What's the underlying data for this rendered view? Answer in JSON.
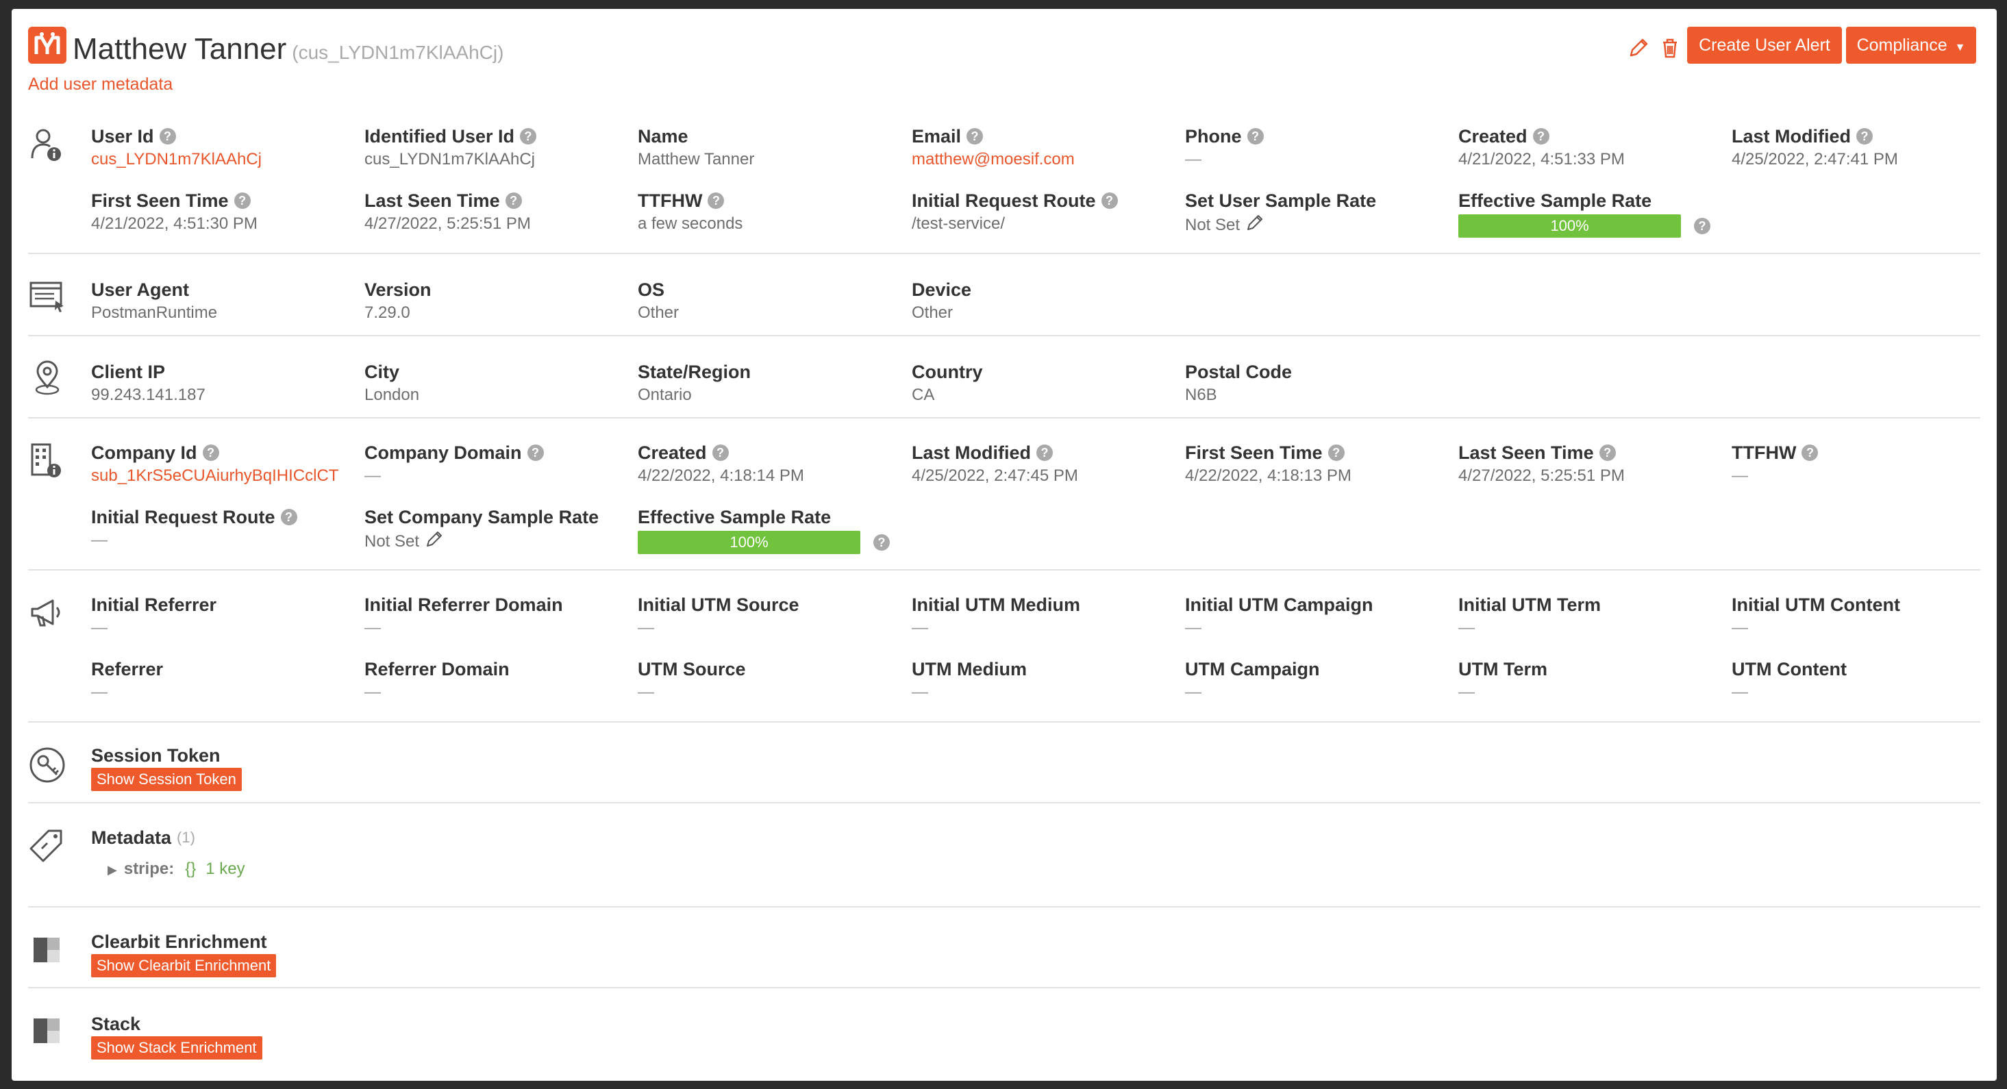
{
  "header": {
    "name": "Matthew Tanner",
    "customer_id": "(cus_LYDN1m7KlAAhCj)",
    "add_metadata_link": "Add user metadata",
    "create_alert_button": "Create User Alert",
    "compliance_button": "Compliance",
    "accent_color": "#ee5a2c"
  },
  "user_section": {
    "row1": [
      {
        "label": "User Id",
        "value": "cus_LYDN1m7KlAAhCj"
      },
      {
        "label": "Identified User Id",
        "value": "cus_LYDN1m7KlAAhCj"
      },
      {
        "label": "Name",
        "value": "Matthew Tanner"
      },
      {
        "label": "Email",
        "value": "matthew@moesif.com"
      },
      {
        "label": "Phone",
        "value": "—"
      },
      {
        "label": "Created",
        "value": "4/21/2022, 4:51:33 PM"
      },
      {
        "label": "Last Modified",
        "value": "4/25/2022, 2:47:41 PM"
      }
    ],
    "row2": [
      {
        "label": "First Seen Time",
        "value": "4/21/2022, 4:51:30 PM"
      },
      {
        "label": "Last Seen Time",
        "value": "4/27/2022, 5:25:51 PM"
      },
      {
        "label": "TTFHW",
        "value": "a few seconds"
      },
      {
        "label": "Initial Request Route",
        "value": "/test-service/"
      },
      {
        "label": "Set User Sample Rate",
        "value": "Not Set"
      },
      {
        "label": "Effective Sample Rate",
        "value": "100%",
        "fill": 1.0
      }
    ]
  },
  "agent_section": {
    "fields": [
      {
        "label": "User Agent",
        "value": "PostmanRuntime"
      },
      {
        "label": "Version",
        "value": "7.29.0"
      },
      {
        "label": "OS",
        "value": "Other"
      },
      {
        "label": "Device",
        "value": "Other"
      }
    ]
  },
  "location_section": {
    "fields": [
      {
        "label": "Client IP",
        "value": "99.243.141.187"
      },
      {
        "label": "City",
        "value": "London"
      },
      {
        "label": "State/Region",
        "value": "Ontario"
      },
      {
        "label": "Country",
        "value": "CA"
      },
      {
        "label": "Postal Code",
        "value": "N6B"
      }
    ]
  },
  "company_section": {
    "row1": [
      {
        "label": "Company Id",
        "value": "sub_1KrS5eCUAiurhyBqIHICclCT"
      },
      {
        "label": "Company Domain",
        "value": "—"
      },
      {
        "label": "Created",
        "value": "4/22/2022, 4:18:14 PM"
      },
      {
        "label": "Last Modified",
        "value": "4/25/2022, 2:47:45 PM"
      },
      {
        "label": "First Seen Time",
        "value": "4/22/2022, 4:18:13 PM"
      },
      {
        "label": "Last Seen Time",
        "value": "4/27/2022, 5:25:51 PM"
      },
      {
        "label": "TTFHW",
        "value": "—"
      }
    ],
    "row2": [
      {
        "label": "Initial Request Route",
        "value": "—"
      },
      {
        "label": "Set Company Sample Rate",
        "value": "Not Set"
      },
      {
        "label": "Effective Sample Rate",
        "value": "100%",
        "fill": 1.0
      }
    ]
  },
  "referrer_section": {
    "row1": [
      {
        "label": "Initial Referrer",
        "value": "—"
      },
      {
        "label": "Initial Referrer Domain",
        "value": "—"
      },
      {
        "label": "Initial UTM Source",
        "value": "—"
      },
      {
        "label": "Initial UTM Medium",
        "value": "—"
      },
      {
        "label": "Initial UTM Campaign",
        "value": "—"
      },
      {
        "label": "Initial UTM Term",
        "value": "—"
      },
      {
        "label": "Initial UTM Content",
        "value": "—"
      }
    ],
    "row2": [
      {
        "label": "Referrer",
        "value": "—"
      },
      {
        "label": "Referrer Domain",
        "value": "—"
      },
      {
        "label": "UTM Source",
        "value": "—"
      },
      {
        "label": "UTM Medium",
        "value": "—"
      },
      {
        "label": "UTM Campaign",
        "value": "—"
      },
      {
        "label": "UTM Term",
        "value": "—"
      },
      {
        "label": "UTM Content",
        "value": "—"
      }
    ]
  },
  "session_section": {
    "label": "Session Token",
    "button": "Show Session Token"
  },
  "metadata_section": {
    "label": "Metadata",
    "count": "(1)",
    "key": "stripe:",
    "brace": "{}",
    "key_count": "1 key"
  },
  "clearbit_section": {
    "label": "Clearbit Enrichment",
    "button": "Show Clearbit Enrichment"
  },
  "stack_section": {
    "label": "Stack",
    "button": "Show Stack Enrichment"
  }
}
